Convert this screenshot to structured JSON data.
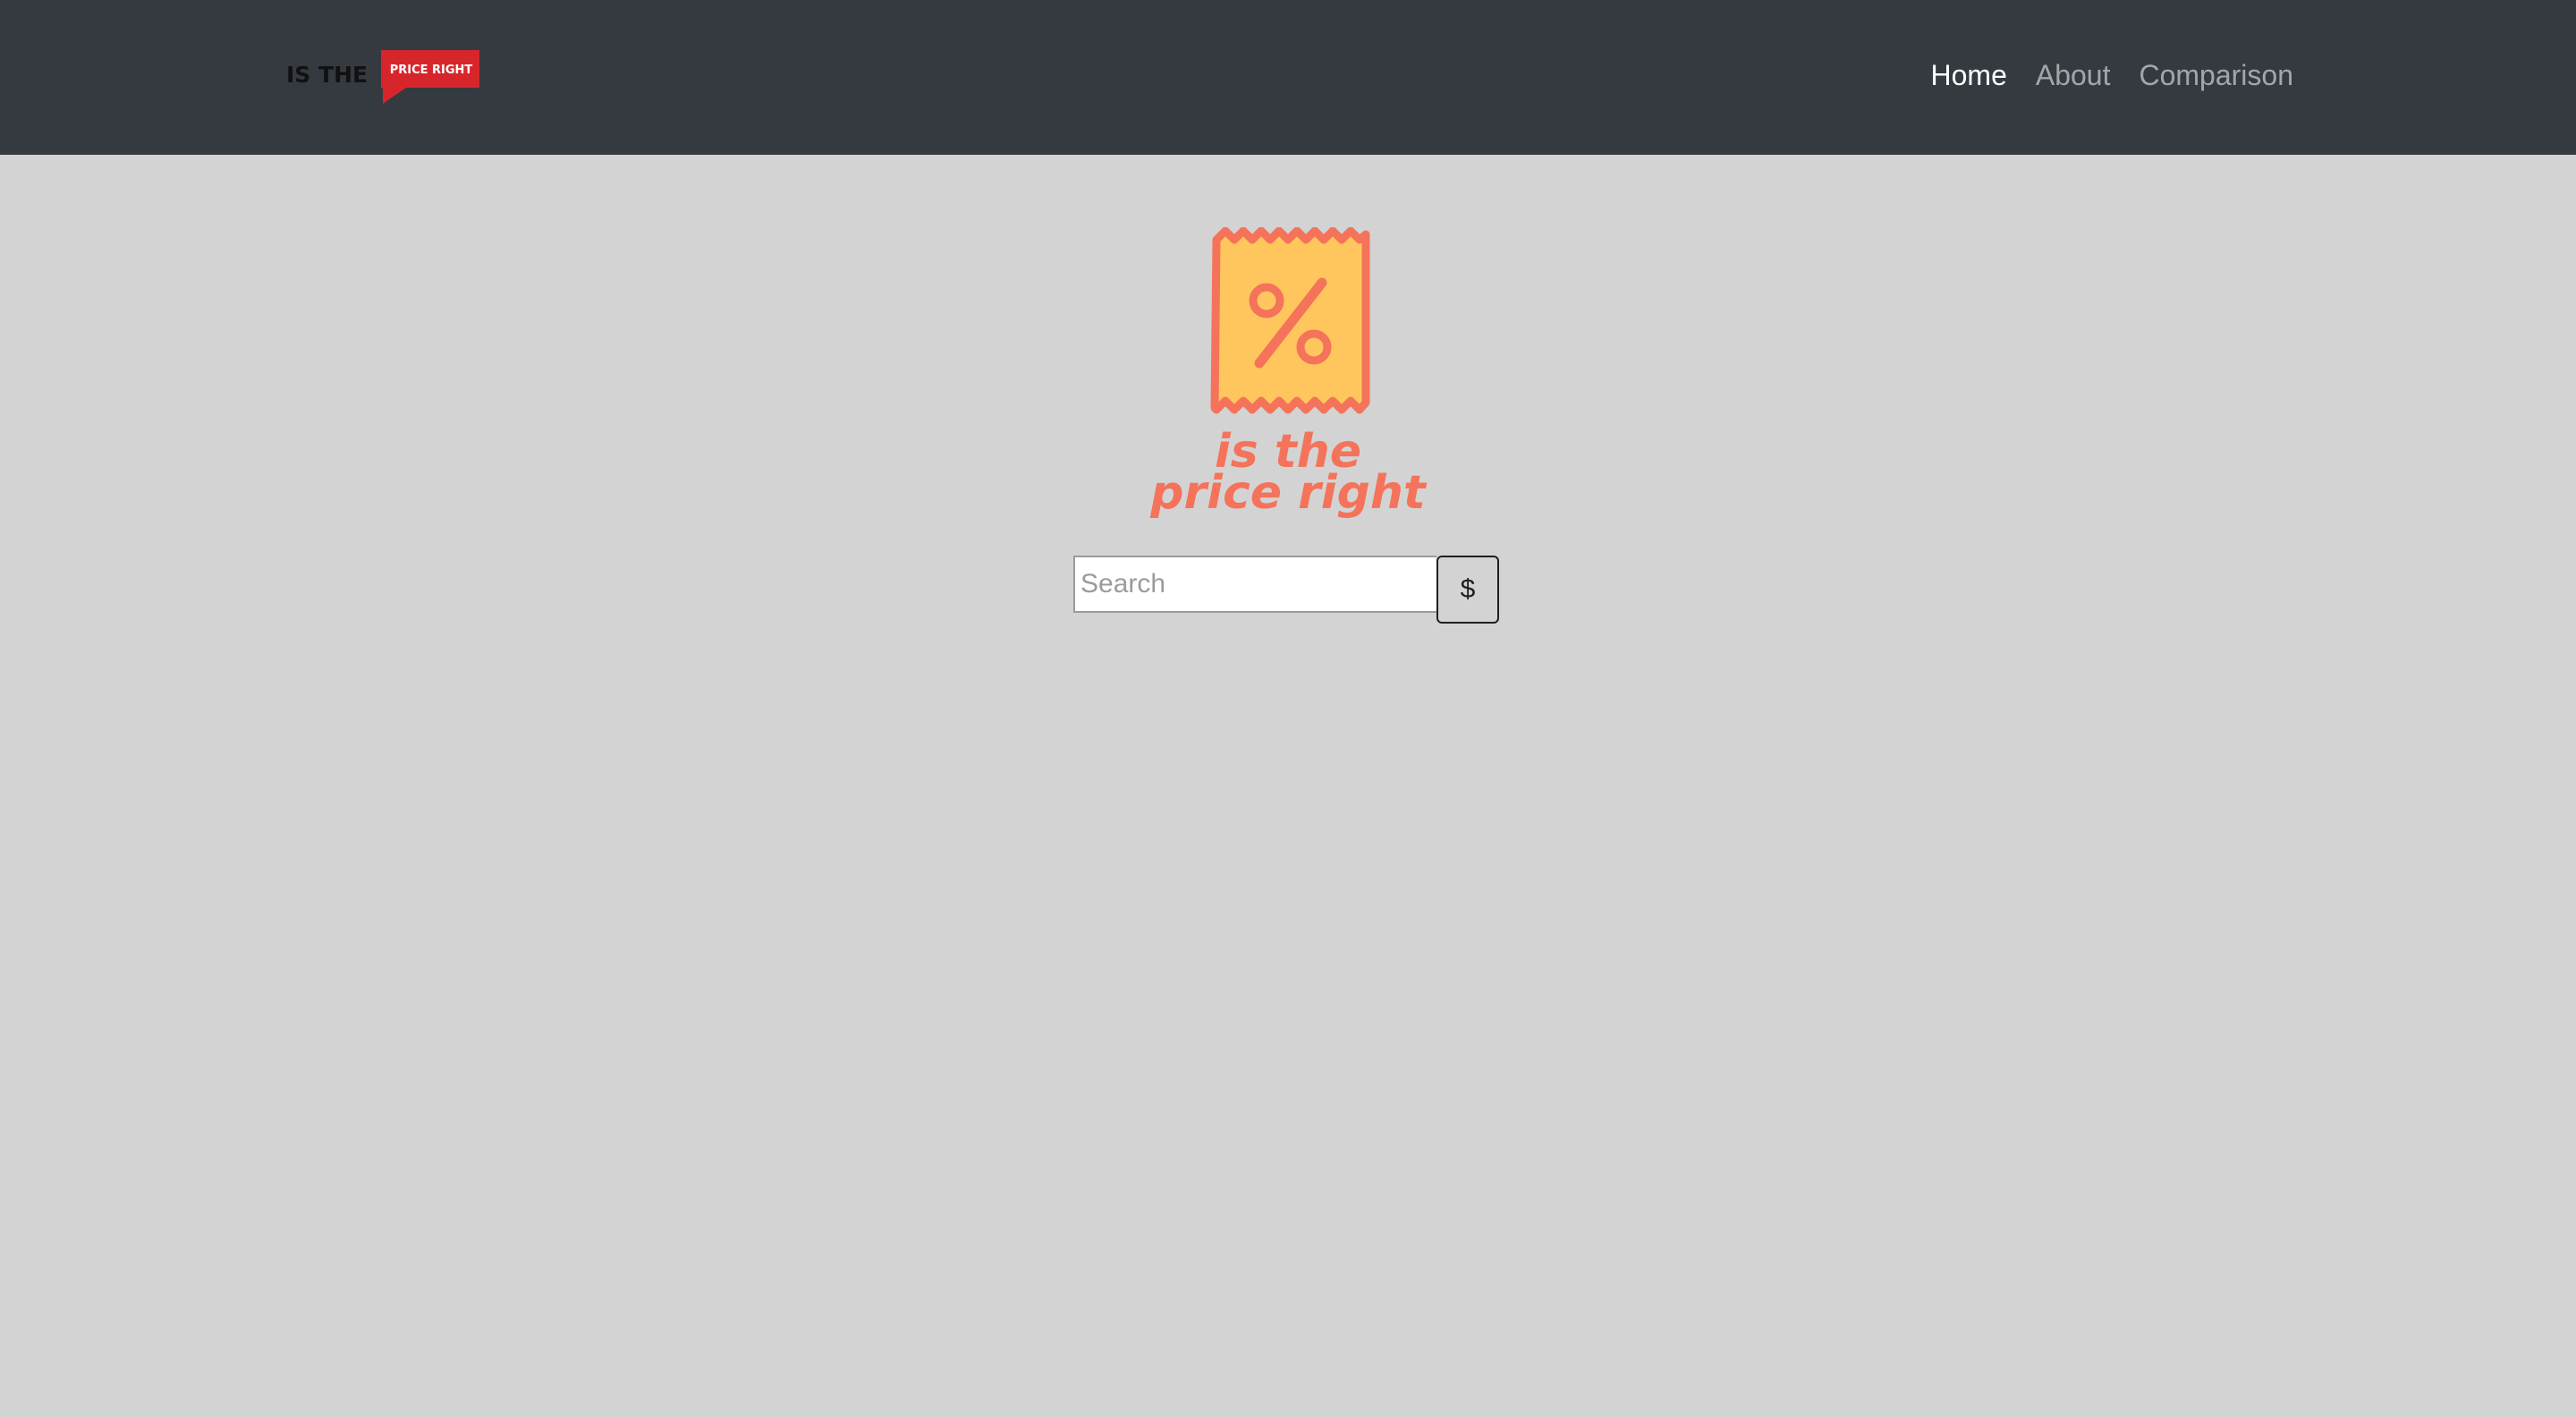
{
  "navbar": {
    "brand_logo": {
      "icon": "price-tag-logo-icon",
      "text_dark": "IS THE",
      "text_tag": "PRICE RIGHT",
      "colors": {
        "dark": "#111111",
        "tag": "#d7262b"
      }
    },
    "links": [
      {
        "label": "Home",
        "active": true
      },
      {
        "label": "About",
        "active": false
      },
      {
        "label": "Comparison",
        "active": false
      }
    ],
    "colors": {
      "background": "#343a40",
      "active_link": "#ffffff",
      "inactive_link": "#9a9da0"
    }
  },
  "hero": {
    "logo": {
      "icon": "discount-receipt-icon",
      "line1": "is the",
      "line2": "price right",
      "colors": {
        "receipt_fill": "#ffc65d",
        "accent": "#f4735a"
      }
    }
  },
  "search": {
    "placeholder": "Search",
    "value": "",
    "button_label": "$"
  },
  "page": {
    "background": "#d3d3d3"
  }
}
